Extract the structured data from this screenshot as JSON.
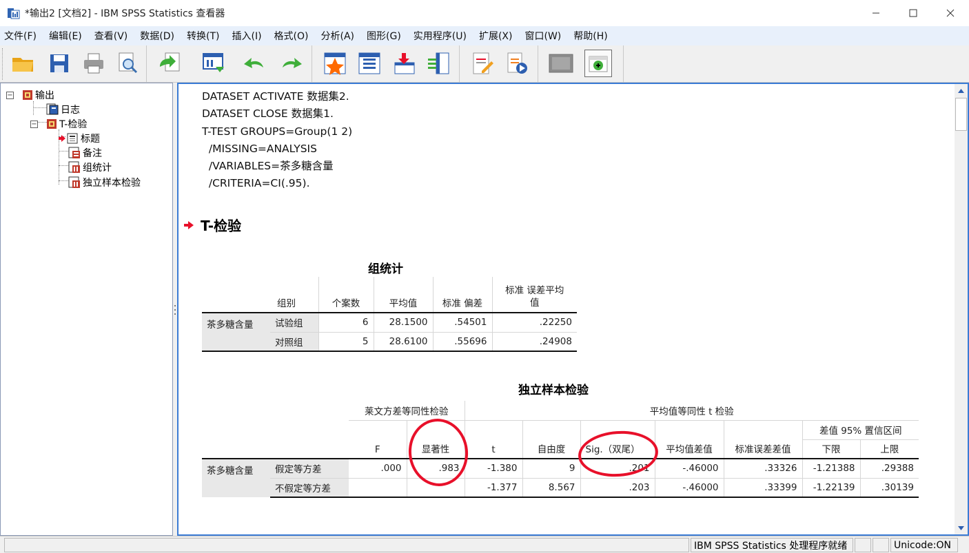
{
  "window": {
    "title": "*输出2 [文档2] - IBM SPSS Statistics 查看器"
  },
  "menu": [
    "文件(F)",
    "编辑(E)",
    "查看(V)",
    "数据(D)",
    "转换(T)",
    "插入(I)",
    "格式(O)",
    "分析(A)",
    "图形(G)",
    "实用程序(U)",
    "扩展(X)",
    "窗口(W)",
    "帮助(H)"
  ],
  "toolbar": {
    "buttons": [
      "open-icon",
      "save-icon",
      "print-icon",
      "print-preview-icon",
      "export-icon",
      "recall-dialog-icon",
      "undo-icon",
      "redo-icon",
      "goto-case-icon",
      "goto-variable-icon",
      "insert-cases-icon",
      "variables-icon",
      "text-output-icon",
      "run-script-icon",
      "designate-window-icon",
      "promote-icon"
    ]
  },
  "tree": {
    "root": "输出",
    "log": "日志",
    "ttest": "T-检验",
    "title": "标题",
    "notes": "备注",
    "group_stats": "组统计",
    "indep_test": "独立样本检验"
  },
  "syntax": [
    "DATASET ACTIVATE 数据集2.",
    "DATASET CLOSE 数据集1.",
    "T-TEST GROUPS=Group(1 2)",
    "  /MISSING=ANALYSIS",
    "  /VARIABLES=茶多糖含量",
    "  /CRITERIA=CI(.95)."
  ],
  "section_title": "T-检验",
  "group_stats": {
    "title": "组统计",
    "headers": {
      "group": "组别",
      "n": "个案数",
      "mean": "平均值",
      "sd": "标准 偏差",
      "se_line1": "标准 误差平均",
      "se_line2": "值"
    },
    "variable": "茶多糖含量",
    "rows": [
      {
        "group": "试验组",
        "n": "6",
        "mean": "28.1500",
        "sd": ".54501",
        "se": ".22250"
      },
      {
        "group": "对照组",
        "n": "5",
        "mean": "28.6100",
        "sd": ".55696",
        "se": ".24908"
      }
    ]
  },
  "indep_test": {
    "title": "独立样本检验",
    "levene_header": "莱文方差等同性检验",
    "ttest_header": "平均值等同性 t 检验",
    "ci_header": "差值 95% 置信区间",
    "col_headers": {
      "F": "F",
      "sig": "显著性",
      "t": "t",
      "df": "自由度",
      "sig2": "Sig.（双尾）",
      "meandiff": "平均值差值",
      "sediff": "标准误差差值",
      "lower": "下限",
      "upper": "上限"
    },
    "variable": "茶多糖含量",
    "rows": [
      {
        "label": "假定等方差",
        "F": ".000",
        "sig": ".983",
        "t": "-1.380",
        "df": "9",
        "sig2": ".201",
        "meandiff": "-.46000",
        "sediff": ".33326",
        "lower": "-1.21388",
        "upper": ".29388"
      },
      {
        "label": "不假定等方差",
        "F": "",
        "sig": "",
        "t": "-1.377",
        "df": "8.567",
        "sig2": ".203",
        "meandiff": "-.46000",
        "sediff": ".33399",
        "lower": "-1.22139",
        "upper": ".30139"
      }
    ]
  },
  "status": {
    "processor": "IBM SPSS Statistics 处理程序就绪",
    "unicode": "Unicode:ON"
  },
  "colors": {
    "accent": "#3a7bd5",
    "annotation": "#e8102a"
  }
}
